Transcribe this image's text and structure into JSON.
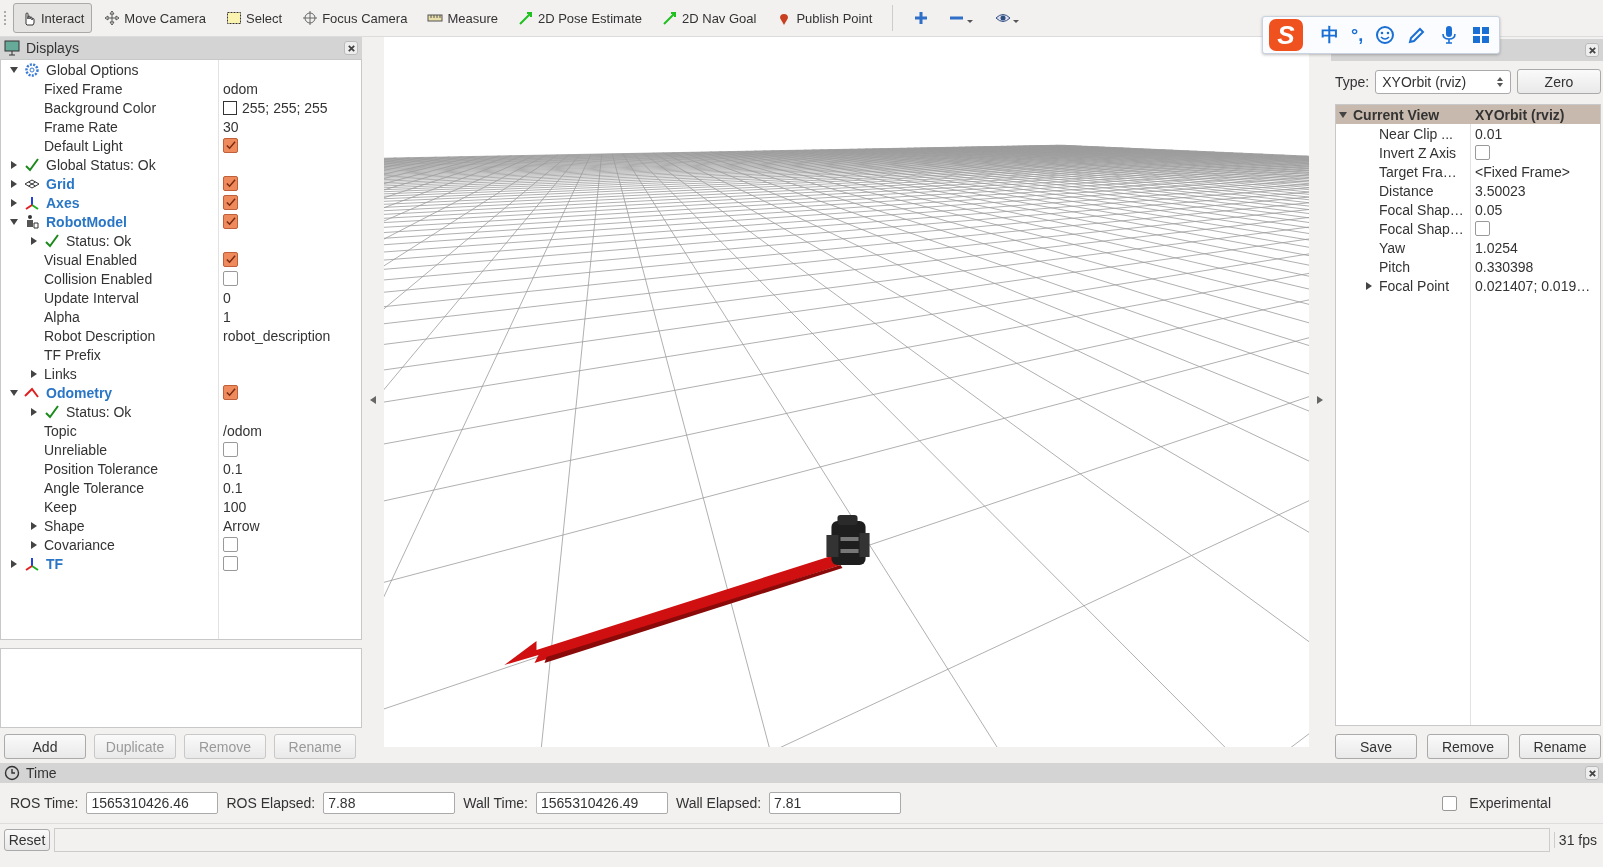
{
  "toolbar": {
    "tools": [
      {
        "kind": "interact",
        "label": "Interact",
        "selected": true
      },
      {
        "kind": "move",
        "label": "Move Camera",
        "selected": false
      },
      {
        "kind": "select",
        "label": "Select",
        "selected": false
      },
      {
        "kind": "focus",
        "label": "Focus Camera",
        "selected": false
      },
      {
        "kind": "measure",
        "label": "Measure",
        "selected": false
      },
      {
        "kind": "pose",
        "label": "2D Pose Estimate",
        "selected": false
      },
      {
        "kind": "nav",
        "label": "2D Nav Goal",
        "selected": false
      },
      {
        "kind": "point",
        "label": "Publish Point",
        "selected": false
      }
    ]
  },
  "ime_bar": {
    "logo": "S",
    "items": [
      {
        "kind": "text",
        "label": "中"
      },
      {
        "kind": "text",
        "label": "°,"
      },
      {
        "kind": "emoji"
      },
      {
        "kind": "pen"
      },
      {
        "kind": "mic"
      },
      {
        "kind": "apps"
      }
    ]
  },
  "displays": {
    "title": "Displays",
    "items": [
      {
        "kind": "options",
        "label": "Global Options",
        "expanded": true,
        "children": [
          {
            "kind": "property",
            "label": "Fixed Frame",
            "value": "odom"
          },
          {
            "kind": "color-property",
            "label": "Background Color",
            "value": "255; 255; 255"
          },
          {
            "kind": "property",
            "label": "Frame Rate",
            "value": "30"
          },
          {
            "kind": "property",
            "label": "Default Light",
            "checked": true
          }
        ]
      },
      {
        "kind": "status",
        "label": "Global Status: Ok",
        "expanded": false
      },
      {
        "kind": "grid",
        "label": "Grid",
        "expanded": false,
        "checked": true
      },
      {
        "kind": "axes",
        "label": "Axes",
        "expanded": false,
        "checked": true
      },
      {
        "kind": "robot",
        "label": "RobotModel",
        "expanded": true,
        "checked": true,
        "children": [
          {
            "kind": "status",
            "label": "Status: Ok",
            "expanded": false
          },
          {
            "kind": "property",
            "label": "Visual Enabled",
            "checked": true
          },
          {
            "kind": "property",
            "label": "Collision Enabled",
            "checked": false
          },
          {
            "kind": "property",
            "label": "Update Interval",
            "value": "0"
          },
          {
            "kind": "property",
            "label": "Alpha",
            "value": "1"
          },
          {
            "kind": "property",
            "label": "Robot Description",
            "value": "robot_description"
          },
          {
            "kind": "property",
            "label": "TF Prefix"
          },
          {
            "kind": "property",
            "label": "Links",
            "expanded": false
          }
        ]
      },
      {
        "kind": "odometry",
        "label": "Odometry",
        "expanded": true,
        "checked": true,
        "children": [
          {
            "kind": "status",
            "label": "Status: Ok",
            "expanded": false
          },
          {
            "kind": "property",
            "label": "Topic",
            "value": "/odom"
          },
          {
            "kind": "property",
            "label": "Unreliable",
            "checked": false
          },
          {
            "kind": "property",
            "label": "Position Tolerance",
            "value": "0.1"
          },
          {
            "kind": "property",
            "label": "Angle Tolerance",
            "value": "0.1"
          },
          {
            "kind": "property",
            "label": "Keep",
            "value": "100"
          },
          {
            "kind": "property",
            "label": "Shape",
            "value": "Arrow",
            "expanded": false
          },
          {
            "kind": "property",
            "label": "Covariance",
            "checked": false,
            "expanded": false
          }
        ]
      },
      {
        "kind": "tf",
        "label": "TF",
        "expanded": false,
        "checked": false
      }
    ],
    "buttons": [
      {
        "label": "Add",
        "disabled": false
      },
      {
        "label": "Duplicate",
        "disabled": true
      },
      {
        "label": "Remove",
        "disabled": true
      },
      {
        "label": "Rename",
        "disabled": true
      }
    ]
  },
  "views": {
    "type_label": "Type:",
    "type_value": "XYOrbit (rviz)",
    "zero_button": "Zero",
    "current": {
      "label": "Current View",
      "value": "XYOrbit (rviz)",
      "expanded": true,
      "children": [
        {
          "label": "Near Clip ...",
          "value": "0.01"
        },
        {
          "label": "Invert Z Axis",
          "checked": false
        },
        {
          "label": "Target Fra…",
          "value": "<Fixed Frame>"
        },
        {
          "label": "Distance",
          "value": "3.50023"
        },
        {
          "label": "Focal Shap…",
          "value": "0.05"
        },
        {
          "label": "Focal Shap…",
          "checked": false
        },
        {
          "label": "Yaw",
          "value": "1.0254"
        },
        {
          "label": "Pitch",
          "value": "0.330398"
        },
        {
          "label": "Focal Point",
          "value": "0.021407; 0.019…",
          "expanded": false
        }
      ]
    },
    "buttons": [
      "Save",
      "Remove",
      "Rename"
    ]
  },
  "time": {
    "title": "Time",
    "fields": [
      {
        "label": "ROS Time:",
        "value": "1565310426.46"
      },
      {
        "label": "ROS Elapsed:",
        "value": "7.88"
      },
      {
        "label": "Wall Time:",
        "value": "1565310426.49"
      },
      {
        "label": "Wall Elapsed:",
        "value": "7.81"
      }
    ],
    "experimental": {
      "label": "Experimental",
      "checked": false
    }
  },
  "status_bar": {
    "reset": "Reset",
    "fps": "31 fps"
  }
}
